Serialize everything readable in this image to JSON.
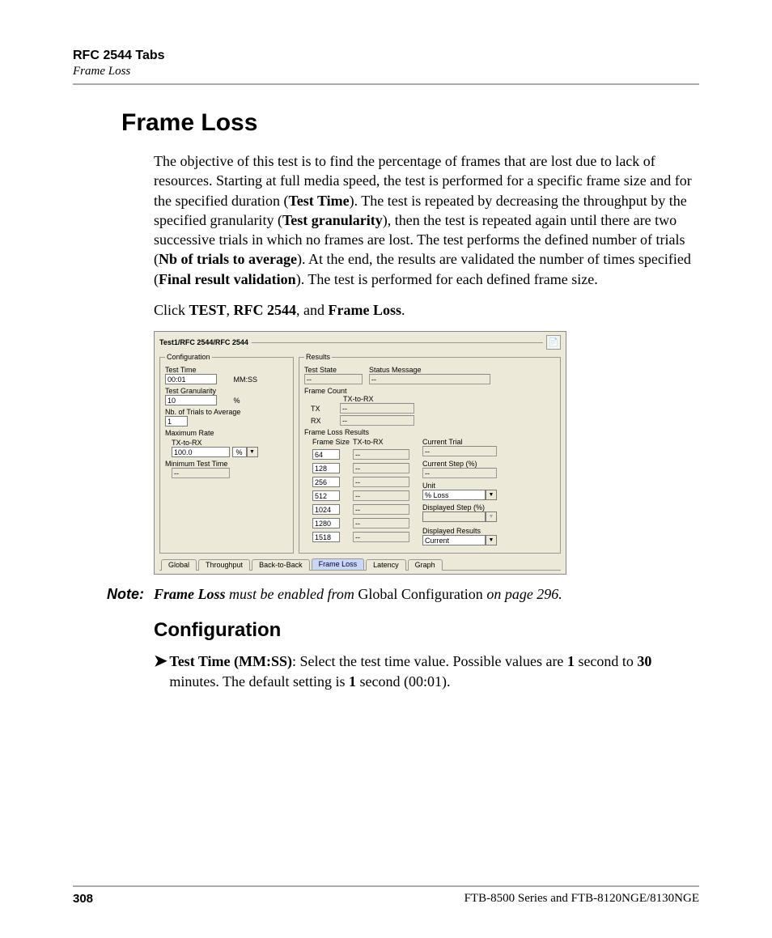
{
  "header": {
    "chapter": "RFC 2544 Tabs",
    "section": "Frame Loss"
  },
  "title": "Frame Loss",
  "intro": {
    "pre1": "The objective of this test is to find the percentage of frames that are lost due to lack of resources. Starting at full media speed, the test is performed for a specific frame size and for the specified duration (",
    "b1": "Test Time",
    "mid1": "). The test is repeated by decreasing the throughput by the specified granularity (",
    "b2": "Test granularity",
    "mid2": "), then the test is repeated again until there are two successive trials in which no frames are lost. The test performs the defined number of trials (",
    "b3": "Nb of trials to average",
    "mid3": "). At the end, the results are validated the number of times specified (",
    "b4": "Final result validation",
    "post": "). The test is performed for each defined frame size."
  },
  "click_line": {
    "pre": "Click ",
    "b1": "TEST",
    "sep1": ", ",
    "b2": "RFC 2544",
    "sep2": ", and ",
    "b3": "Frame Loss",
    "post": "."
  },
  "screenshot": {
    "breadcrumb": "Test1/RFC 2544/RFC 2544",
    "config": {
      "legend": "Configuration",
      "test_time_label": "Test Time",
      "test_time_value": "00:01",
      "test_time_unit": "MM:SS",
      "granularity_label": "Test Granularity",
      "granularity_value": "10",
      "granularity_unit": "%",
      "trials_label": "Nb. of Trials to Average",
      "trials_value": "1",
      "max_rate_label": "Maximum Rate",
      "tx_to_rx_label": "TX-to-RX",
      "max_rate_value": "100.0",
      "max_rate_unit": "%",
      "min_test_time_label": "Minimum Test Time",
      "min_test_time_value": "--"
    },
    "results": {
      "legend": "Results",
      "test_state_label": "Test State",
      "test_state_value": "--",
      "status_msg_label": "Status Message",
      "status_msg_value": "--",
      "frame_count_label": "Frame Count",
      "tx_to_rx_label": "TX-to-RX",
      "tx_label": "TX",
      "tx_value": "--",
      "rx_label": "RX",
      "rx_value": "--",
      "frame_loss_legend": "Frame Loss Results",
      "fs_header": "Frame Size",
      "txrx_header": "TX-to-RX",
      "rows": [
        {
          "size": "64",
          "val": "--"
        },
        {
          "size": "128",
          "val": "--"
        },
        {
          "size": "256",
          "val": "--"
        },
        {
          "size": "512",
          "val": "--"
        },
        {
          "size": "1024",
          "val": "--"
        },
        {
          "size": "1280",
          "val": "--"
        },
        {
          "size": "1518",
          "val": "--"
        }
      ],
      "current_trial_label": "Current Trial",
      "current_trial_value": "--",
      "current_step_label": "Current Step (%)",
      "current_step_value": "--",
      "unit_label": "Unit",
      "unit_value": "% Loss",
      "disp_step_label": "Displayed Step (%)",
      "disp_step_value": "",
      "disp_results_label": "Displayed Results",
      "disp_results_value": "Current"
    },
    "tabs": [
      "Global",
      "Throughput",
      "Back-to-Back",
      "Frame Loss",
      "Latency",
      "Graph"
    ],
    "active_tab": "Frame Loss"
  },
  "note": {
    "label": "Note:",
    "i1": "Frame Loss",
    "mid1": " must be enabled from ",
    "u1": "Global Configuration",
    "mid2": " on page 296."
  },
  "subheading": "Configuration",
  "bullet": {
    "b1": "Test Time (MM:SS)",
    "t1": ": Select the test time value. Possible values are ",
    "b2": "1",
    "t2": " second to ",
    "b3": "30",
    "t3": " minutes. The default setting is ",
    "b4": "1",
    "t4": " second (00:01)."
  },
  "footer": {
    "page": "308",
    "info": "FTB-8500 Series and FTB-8120NGE/8130NGE"
  }
}
